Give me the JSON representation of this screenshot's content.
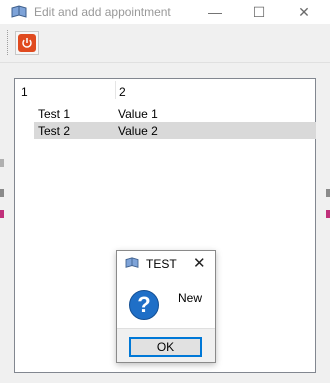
{
  "window": {
    "title": "Edit and add appointment",
    "minimize_glyph": "—",
    "maximize_glyph": "☐",
    "close_glyph": "✕"
  },
  "toolbar": {
    "power_icon": "power-icon",
    "accent": "#e04a1f"
  },
  "table": {
    "columns": [
      "1",
      "2"
    ],
    "rows": [
      {
        "c1": "Test 1",
        "c2": "Value 1",
        "selected": false
      },
      {
        "c1": "Test 2",
        "c2": "Value 2",
        "selected": true
      }
    ]
  },
  "dialog": {
    "title": "TEST",
    "message": "New",
    "ok_label": "OK",
    "close_glyph": "✕",
    "icon": "question-icon"
  }
}
